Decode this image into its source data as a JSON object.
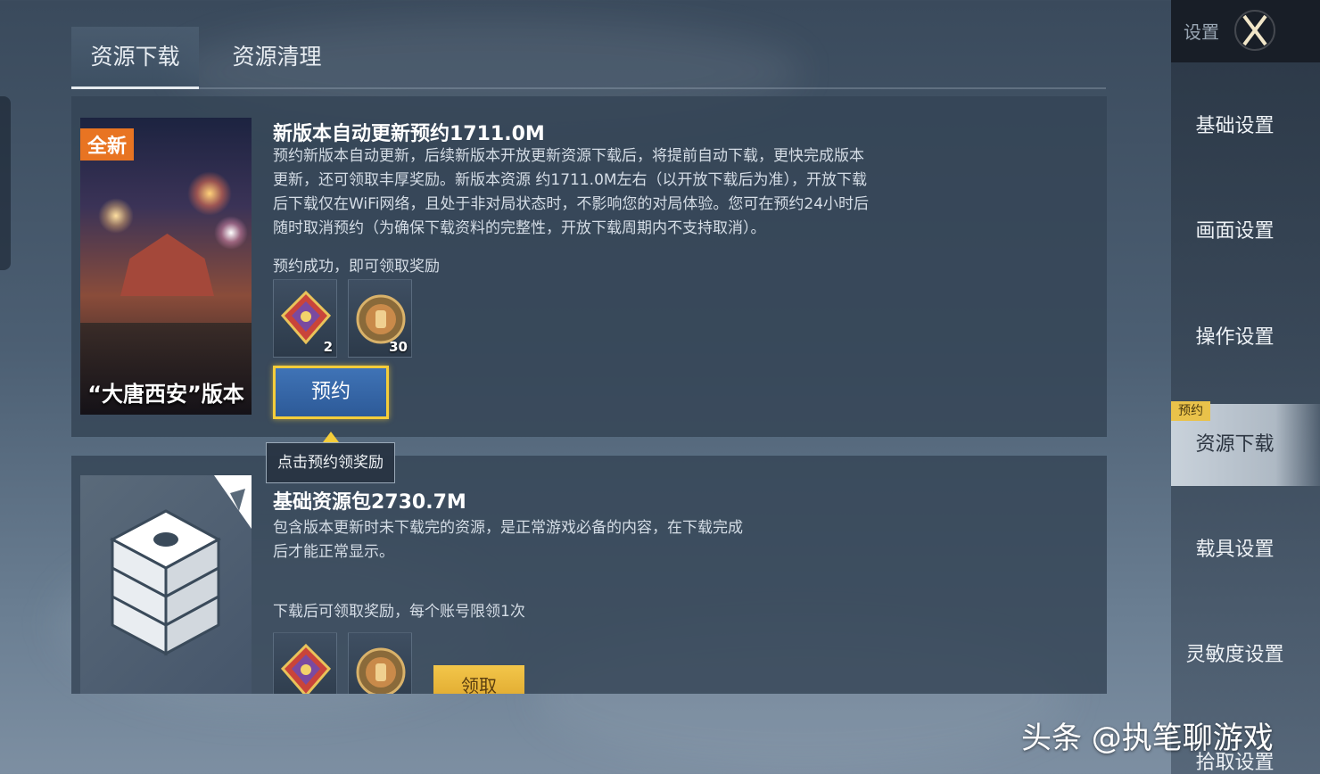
{
  "tabs": [
    {
      "label": "资源下载",
      "active": true
    },
    {
      "label": "资源清理",
      "active": false
    }
  ],
  "panel1": {
    "badge": "全新",
    "cover_caption": "“大唐西安”版本",
    "title": "新版本自动更新预约1711.0M",
    "description": [
      "预约新版本自动更新，后续新版本开放更新资源下载后，将提前自动下载，更快完成版本",
      "更新，还可领取丰厚奖励。新版本资源 约1711.0M左右（以开放下载后为准），开放下载",
      "后下载仅在WiFi网络，且处于非对局状态时，不影响您的对局体验。您可在预约24小时后",
      "随时取消预约（为确保下载资料的完整性，开放下载周期内不支持取消）。"
    ],
    "reward_note": "预约成功，即可领取奖励",
    "rewards": [
      {
        "icon": "card-icon",
        "qty": "2"
      },
      {
        "icon": "medal-icon",
        "qty": "30"
      }
    ],
    "button": "预约",
    "tooltip": "点击预约领奖励"
  },
  "panel2": {
    "title": "基础资源包2730.7M",
    "description": [
      "包含版本更新时未下载完的资源，是正常游戏必备的内容，在下载完成",
      "后才能正常显示。"
    ],
    "reward_note": "下载后可领取奖励，每个账号限领1次",
    "rewards": [
      {
        "icon": "card-icon",
        "qty": ""
      },
      {
        "icon": "medal-icon",
        "qty": ""
      }
    ],
    "button": "领取"
  },
  "sidebar": {
    "header": "设置",
    "items": [
      {
        "label": "基础设置"
      },
      {
        "label": "画面设置"
      },
      {
        "label": "操作设置"
      },
      {
        "label": "资源下载",
        "active": true,
        "badge": "预约"
      },
      {
        "label": "载具设置"
      },
      {
        "label": "灵敏度设置"
      },
      {
        "label": "拾取设置"
      }
    ]
  },
  "watermark": "头条 @执笔聊游戏",
  "colors": {
    "accent_yellow": "#f5cd3a",
    "badge_orange": "#e87422",
    "button_blue": "#3f73b6"
  }
}
